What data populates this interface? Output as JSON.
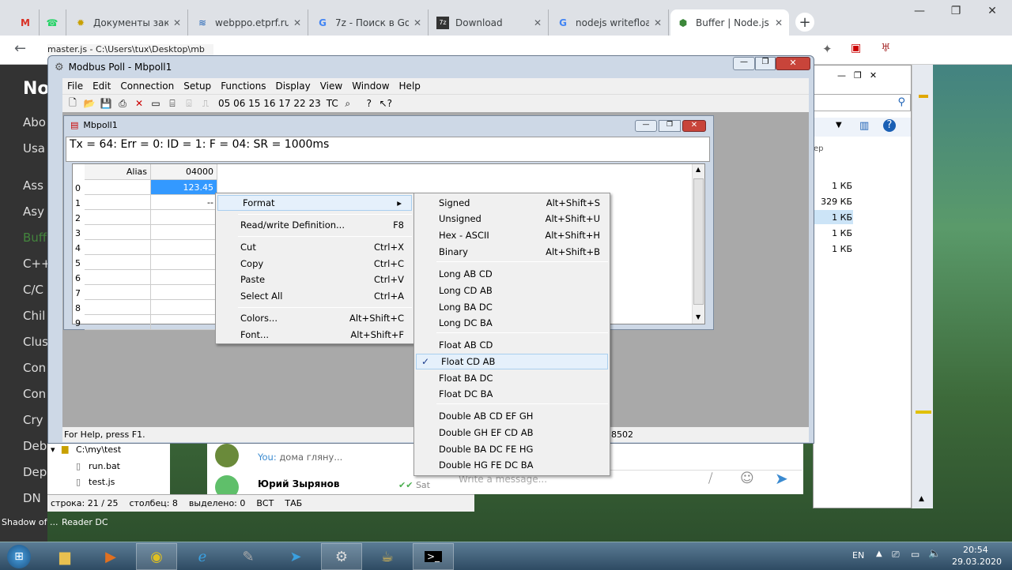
{
  "browser": {
    "tabs": [
      {
        "icon": "M",
        "label": "",
        "color": "#d93025"
      },
      {
        "icon": "☎",
        "label": "",
        "color": "#25d366"
      },
      {
        "icon": "✹",
        "label": "Документы закуп",
        "color": "#c8a000"
      },
      {
        "icon": "≋",
        "label": "webppo.etprf.ru/L",
        "color": "#1a5fb4"
      },
      {
        "icon": "G",
        "label": "7z - Поиск в Goo",
        "color": "#4285f4"
      },
      {
        "icon": "7z",
        "label": "Download",
        "color": "#333"
      },
      {
        "icon": "G",
        "label": "nodejs writefloatl",
        "color": "#4285f4"
      },
      {
        "icon": "⬢",
        "label": "Buffer | Node.js v1",
        "color": "#3c873a"
      }
    ],
    "back": "←"
  },
  "node_sidebar": {
    "title": "No",
    "items": [
      "Abo",
      "Usa",
      "Ass",
      "Asy",
      "Buff",
      "C++",
      "C/C",
      "Chil",
      "Clus",
      "Con",
      "Con",
      "Cry",
      "Deb",
      "Dep",
      "DN"
    ]
  },
  "explorer": {
    "sizes": [
      "1 КБ",
      "329 КБ",
      "1 КБ",
      "1 КБ",
      "1 КБ"
    ],
    "col": "ер"
  },
  "notepad": {
    "path": "master.js - C:\\Users\\tux\\Desktop\\mb",
    "status": [
      "строка: 21 / 25",
      "столбец: 8",
      "выделено: 0",
      "ВСТ",
      "ТАБ"
    ]
  },
  "tree": {
    "items": [
      "C:\\my\\test",
      "run.bat",
      "test.js"
    ]
  },
  "telegram": {
    "you": "You:",
    "msg": "дома гляну...",
    "name": "Юрий Зырянов",
    "time": "Sat",
    "placeholder": "Write a message..."
  },
  "desktop": {
    "labels": [
      "Shadow of ...",
      "Reader DC"
    ]
  },
  "modbus": {
    "title": "Modbus Poll - Mbpoll1",
    "menu": [
      "File",
      "Edit",
      "Connection",
      "Setup",
      "Functions",
      "Display",
      "View",
      "Window",
      "Help"
    ],
    "fcodes": "05 06 15 16 17 22 23",
    "tc": "TC",
    "status": "For Help, press F1.",
    "status_right": "8502",
    "child": {
      "title": "Mbpoll1",
      "header": "Tx = 64: Err = 0: ID = 1: F = 04: SR = 1000ms",
      "col_alias": "Alias",
      "col_addr": "04000",
      "rows": [
        "0",
        "1",
        "2",
        "3",
        "4",
        "5",
        "6",
        "7",
        "8",
        "9"
      ],
      "values": [
        "123.45",
        "--",
        "",
        "",
        "",
        "",
        "",
        "",
        "",
        ""
      ]
    }
  },
  "context_menu": {
    "items": [
      {
        "label": "Format",
        "key": "▸",
        "submenu": true
      },
      {
        "label": "Read/write Definition...",
        "key": "F8"
      },
      {
        "label": "Cut",
        "key": "Ctrl+X"
      },
      {
        "label": "Copy",
        "key": "Ctrl+C"
      },
      {
        "label": "Paste",
        "key": "Ctrl+V"
      },
      {
        "label": "Select All",
        "key": "Ctrl+A"
      },
      {
        "label": "Colors...",
        "key": "Alt+Shift+C"
      },
      {
        "label": "Font...",
        "key": "Alt+Shift+F"
      }
    ]
  },
  "format_menu": {
    "items": [
      {
        "label": "Signed",
        "key": "Alt+Shift+S"
      },
      {
        "label": "Unsigned",
        "key": "Alt+Shift+U"
      },
      {
        "label": "Hex - ASCII",
        "key": "Alt+Shift+H"
      },
      {
        "label": "Binary",
        "key": "Alt+Shift+B"
      },
      {
        "label": "Long AB CD",
        "key": ""
      },
      {
        "label": "Long CD AB",
        "key": ""
      },
      {
        "label": "Long BA DC",
        "key": ""
      },
      {
        "label": "Long DC BA",
        "key": ""
      },
      {
        "label": "Float AB CD",
        "key": ""
      },
      {
        "label": "Float CD AB",
        "key": "",
        "checked": true
      },
      {
        "label": "Float BA DC",
        "key": ""
      },
      {
        "label": "Float DC BA",
        "key": ""
      },
      {
        "label": "Double AB CD EF GH",
        "key": ""
      },
      {
        "label": "Double GH EF CD AB",
        "key": ""
      },
      {
        "label": "Double BA DC FE HG",
        "key": ""
      },
      {
        "label": "Double HG FE DC BA",
        "key": ""
      }
    ]
  },
  "tray": {
    "lang": "EN",
    "time": "20:54",
    "date": "29.03.2020"
  }
}
